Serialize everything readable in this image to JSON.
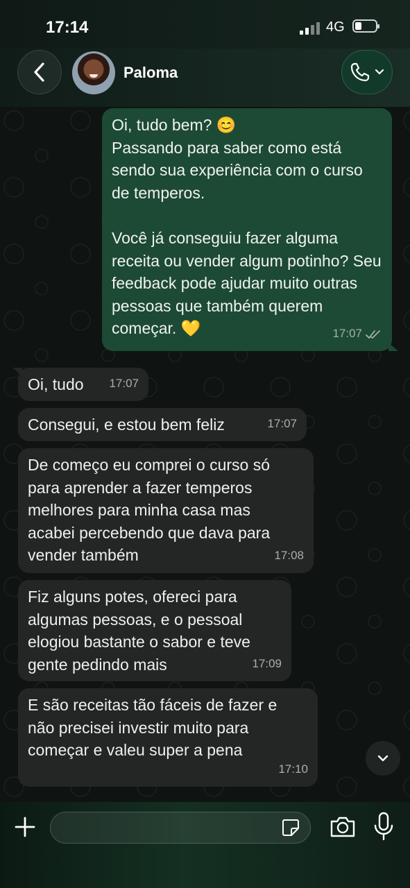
{
  "status_bar": {
    "time": "17:14",
    "network": "4G"
  },
  "header": {
    "contact_name": "Paloma"
  },
  "messages": [
    {
      "direction": "out",
      "text": "Oi, tudo bem? 😊\nPassando para saber como está sendo sua experiência com o curso de temperos.\n\nVocê já conseguiu fazer alguma receita ou vender algum potinho? Seu feedback pode ajudar muito outras pessoas que também querem começar. 💛",
      "time": "17:07",
      "status": "read"
    },
    {
      "direction": "in",
      "text": "Oi, tudo",
      "time": "17:07"
    },
    {
      "direction": "in",
      "text": "Consegui, e estou bem feliz",
      "time": "17:07"
    },
    {
      "direction": "in",
      "text": "De começo eu comprei o curso só para aprender a fazer temperos melhores para minha casa mas acabei percebendo que dava para vender também",
      "time": "17:08"
    },
    {
      "direction": "in",
      "text": "Fiz alguns potes, ofereci para algumas pessoas, e o pessoal elogiou bastante o sabor e teve gente pedindo mais",
      "time": "17:09"
    },
    {
      "direction": "in",
      "text": "E são receitas tão fáceis de fazer e não precisei investir muito para começar e valeu super a pena",
      "time": "17:10"
    }
  ],
  "composer": {
    "value": "",
    "placeholder": ""
  },
  "colors": {
    "outgoing_bubble": "#1d4a34",
    "incoming_bubble": "#242626",
    "read_ticks": "#a6b0ab"
  },
  "icons": [
    "back-icon",
    "phone-icon",
    "chevron-down-icon",
    "plus-icon",
    "sticker-icon",
    "camera-icon",
    "microphone-icon",
    "double-check-icon"
  ]
}
